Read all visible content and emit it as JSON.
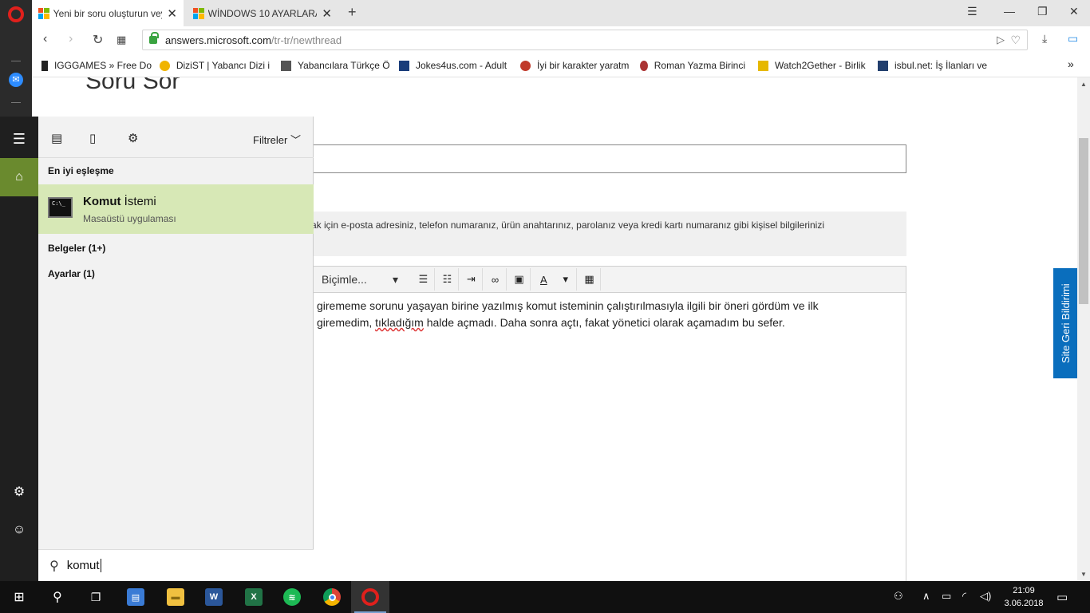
{
  "browser": {
    "tabs": [
      {
        "title": "Yeni bir soru oluşturun vey"
      },
      {
        "title": "WİNDOWS 10 AYARLARA GİR"
      }
    ],
    "url": {
      "host": "answers.microsoft.com",
      "path": "/tr-tr/newthread"
    },
    "bookmarks": [
      {
        "label": "IGGGAMES » Free Do"
      },
      {
        "label": "DiziST | Yabancı Dizi i"
      },
      {
        "label": "Yabancılara Türkçe Ö"
      },
      {
        "label": "Jokes4us.com - Adult"
      },
      {
        "label": "İyi bir karakter yaratm"
      },
      {
        "label": "Roman Yazma Birinci"
      },
      {
        "label": "Watch2Gether - Birlik"
      },
      {
        "label": "isbul.net: İş İlanları ve"
      }
    ],
    "more_bookmarks": "»"
  },
  "page": {
    "heading": "Soru Sor",
    "privacy_note": "mak için e-posta adresiniz, telefon numaranız, ürün anahtarınız, parolanız veya kredi kartı numaranız gibi kişisel bilgilerinizi",
    "format_select": "Biçimle...",
    "editor_text_line1": "girememe sorunu yaşayan birine yazılmış komut isteminin çalıştırılmasıyla ilgili bir öneri gördüm ve ilk",
    "editor_text_line2_a": "giremedim, ",
    "editor_text_line2_b": "tıkladığım",
    "editor_text_line2_c": " halde açmadı. Daha sonra açtı, fakat yönetici olarak açamadım bu sefer.",
    "feedback_tab": "Site Geri Bildirimi"
  },
  "start_search": {
    "filters_label": "Filtreler",
    "best_match_heading": "En iyi eşleşme",
    "best_match": {
      "title_bold": "Komut",
      "title_rest": " İstemi",
      "subtitle": "Masaüstü uygulaması"
    },
    "categories": [
      "Belgeler (1+)",
      "Ayarlar (1)"
    ],
    "query": "komut"
  },
  "taskbar": {
    "time": "21:09",
    "date": "3.06.2018",
    "apps": [
      "file-explorer",
      "word",
      "excel",
      "spotify",
      "chrome",
      "opera"
    ]
  },
  "colors": {
    "accent_green": "#6a8a2e",
    "best_match_bg": "#d7e8b6",
    "opera_red": "#e0201c",
    "feedback_blue": "#0a6ebd"
  }
}
